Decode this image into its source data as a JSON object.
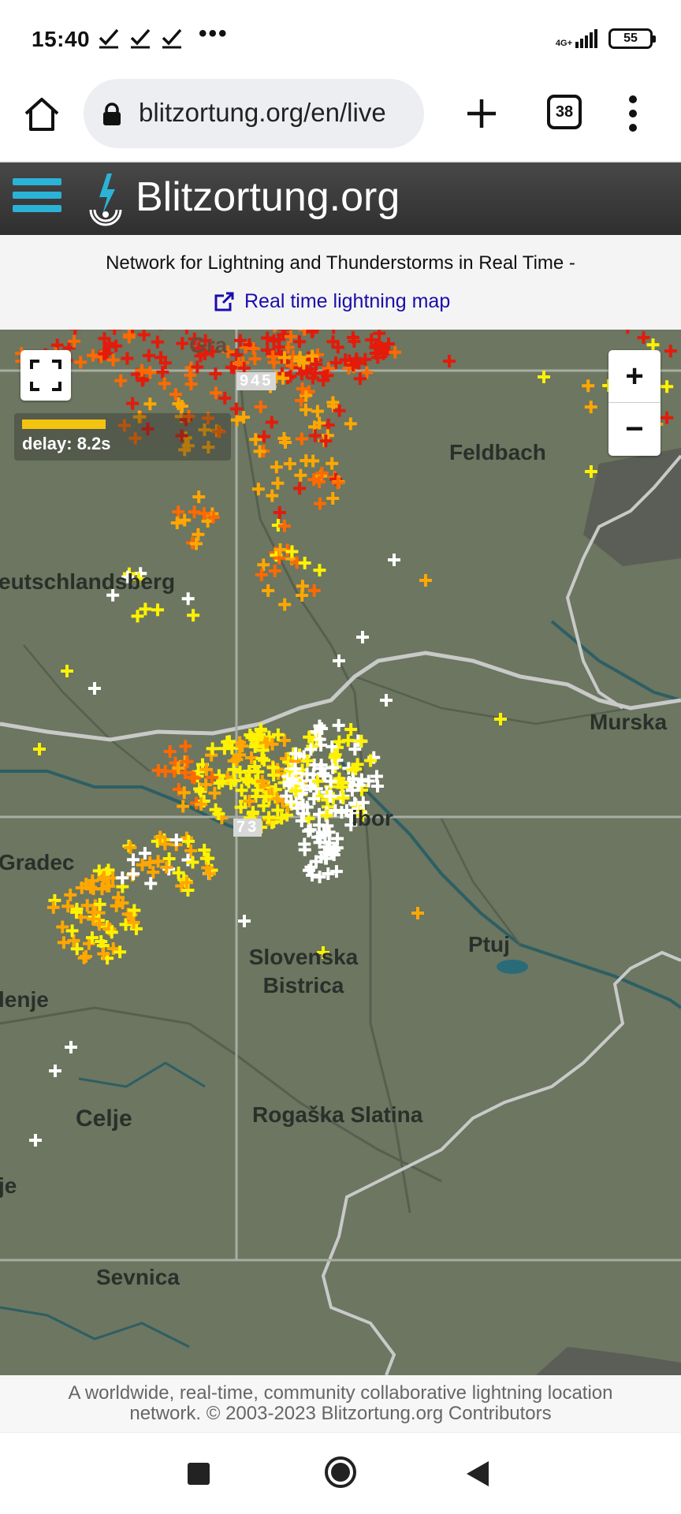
{
  "status_bar": {
    "time": "15:40",
    "dots": "•••",
    "network": "4G+",
    "battery": "55"
  },
  "browser": {
    "url": "blitzortung.org/en/live",
    "tab_count": "38"
  },
  "site": {
    "title": "Blitzortung.org",
    "tagline": "Network for Lightning and Thunderstorms in Real Time -",
    "link_label": "Real time lightning map",
    "accent_color": "#2ab3d6"
  },
  "map": {
    "delay_text": "delay: 8.2s",
    "zoom_in": "+",
    "zoom_out": "−",
    "tile_labels": [
      "945",
      "73"
    ],
    "places": [
      "Feldbach",
      "eutschlandsberg",
      "Murska",
      "Gradec",
      "Slovenska Bistrica",
      "Ptuj",
      "lenje",
      "Celje",
      "Rogaška Slatina",
      "je",
      "Sevnica",
      "Gra",
      "ibor"
    ],
    "strike_colors": {
      "oldest": "#e31b0b",
      "old": "#ff6a00",
      "medium": "#ffa700",
      "recent": "#fff200",
      "newest": "#ffffff"
    }
  },
  "footer": {
    "line1": "A worldwide, real-time, community collaborative lightning location",
    "line2": "network. © 2003-2023 Blitzortung.org Contributors"
  }
}
